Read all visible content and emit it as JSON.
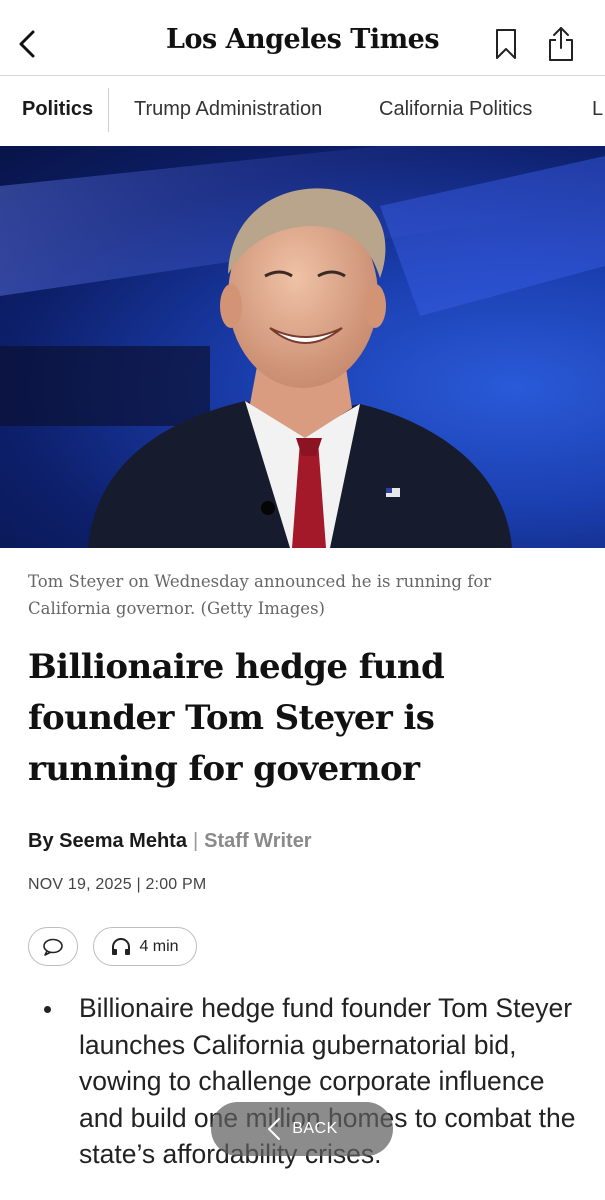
{
  "header": {
    "masthead": "Los Angeles Times",
    "back_icon": "chevron-left-icon",
    "bookmark_icon": "bookmark-icon",
    "share_icon": "share-icon"
  },
  "section_nav": {
    "items": [
      {
        "label": "Politics",
        "active": true
      },
      {
        "label": "Trump Administration",
        "active": false
      },
      {
        "label": "California Politics",
        "active": false
      },
      {
        "label": "L",
        "active": false
      }
    ]
  },
  "hero": {
    "caption": "Tom Steyer on Wednesday announced he is running for California governor. (Getty Images)"
  },
  "article": {
    "headline": "Billionaire hedge fund founder Tom Steyer is running for governor",
    "author": "By Seema Mehta",
    "separator": "|",
    "role": "Staff Writer",
    "dateline": "NOV 19, 2025 | 2:00 PM",
    "listen_duration": "4 min",
    "summary_bullets": [
      "Billionaire hedge fund founder Tom Steyer launches California gubernatorial bid, vowing to challenge corporate influence and build one million homes to combat the state’s affordability crises."
    ]
  },
  "overlay": {
    "back_label": "BACK"
  },
  "colors": {
    "accent_text": "#1a1a1a",
    "muted_text": "#8a8a8a",
    "hero_blue": "#1b3fb0"
  }
}
